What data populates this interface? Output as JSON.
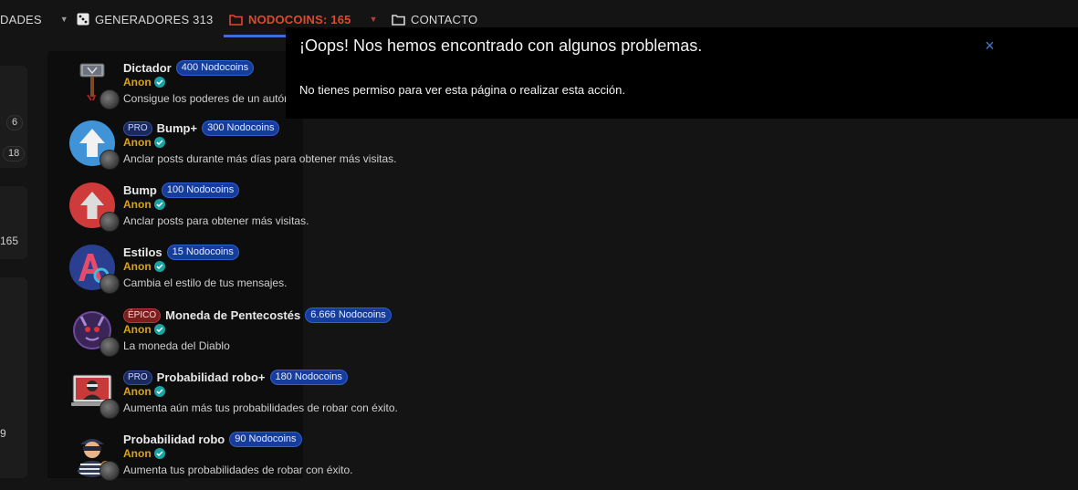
{
  "nav": {
    "item1": "DADES",
    "item2": "GENERADORES 313",
    "item3": "NODOCOINS: 165",
    "item4": "CONTACTO"
  },
  "sidebar": {
    "pill1": "6",
    "pill2": "18",
    "num1": "165",
    "num2": "9"
  },
  "items": [
    {
      "name": "Dictador",
      "tag": "",
      "price": "400 Nodocoins",
      "user": "Anon",
      "desc": "Consigue los poderes de un autór"
    },
    {
      "name": "Bump+",
      "tag": "PRO",
      "price": "300 Nodocoins",
      "user": "Anon",
      "desc": "Anclar posts durante más días para obtener más visitas."
    },
    {
      "name": "Bump",
      "tag": "",
      "price": "100 Nodocoins",
      "user": "Anon",
      "desc": "Anclar posts para obtener más visitas."
    },
    {
      "name": "Estilos",
      "tag": "",
      "price": "15 Nodocoins",
      "user": "Anon",
      "desc": "Cambia el estilo de tus mensajes."
    },
    {
      "name": "Moneda de Pentecostés",
      "tag": "ÉPICO",
      "price": "6.666 Nodocoins",
      "user": "Anon",
      "desc": "La moneda del Diablo"
    },
    {
      "name": "Probabilidad robo+",
      "tag": "PRO",
      "price": "180 Nodocoins",
      "user": "Anon",
      "desc": "Aumenta aún más tus probabilidades de robar con éxito."
    },
    {
      "name": "Probabilidad robo",
      "tag": "",
      "price": "90 Nodocoins",
      "user": "Anon",
      "desc": "Aumenta tus probabilidades de robar con éxito."
    }
  ],
  "error": {
    "title": "¡Oops! Nos hemos encontrado con algunos problemas.",
    "message": "No tienes permiso para ver esta página o realizar esta acción.",
    "close": "×"
  },
  "icons": {
    "caret": "chevron-down-icon",
    "generators": "dice-icon",
    "folder": "folder-icon",
    "verified": "check-circle-icon",
    "close": "close-icon"
  },
  "colors": {
    "active_nav": "#e0482d",
    "underline": "#3b6fd9",
    "price_badge": "#163d9b",
    "user": "#d9a21b",
    "verified": "#1aa3a3",
    "close": "#3b7ddd"
  }
}
